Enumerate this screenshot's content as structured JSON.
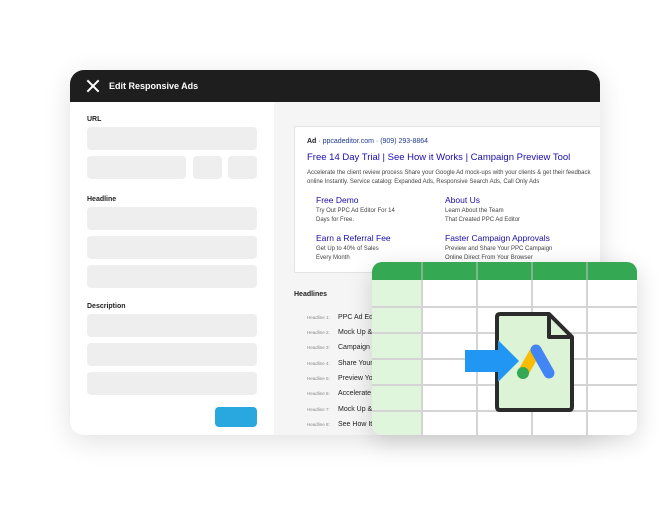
{
  "window": {
    "title": "Edit Responsive Ads",
    "close_icon": "close-icon"
  },
  "form": {
    "url_label": "URL",
    "headline_label": "Headline",
    "description_label": "Description",
    "submit_color": "#29a8e0"
  },
  "ad": {
    "badge": "Ad",
    "domain": "ppcadeditor.com",
    "phone": "(909) 293-8864",
    "title": "Free 14 Day Trial | See How it Works | Campaign Preview Tool",
    "description": "Accelerate the client review process Share your Google Ad mock-ups with your clients & get their feedback online Instantly. Service catalog: Expanded Ads, Responsive Search Ads, Call Only Ads",
    "sitelinks": [
      {
        "title": "Free Demo",
        "line1": "Try Out PPC Ad Editor For 14",
        "line2": "Days for Free."
      },
      {
        "title": "About Us",
        "line1": "Learn About the Team",
        "line2": "That Created PPC Ad Editor"
      },
      {
        "title": "Earn a Referral Fee",
        "line1": "Get Up to 40% of Sales",
        "line2": "Every Month"
      },
      {
        "title": "Faster Campaign Approvals",
        "line1": "Preview and Share Your PPC Campaign",
        "line2": "Online Direct From Your Browser"
      }
    ]
  },
  "headlines": {
    "heading": "Headlines",
    "items": [
      {
        "label": "Headline 1:",
        "text": "PPC Ad Edi"
      },
      {
        "label": "Headline 2:",
        "text": "Mock Up &"
      },
      {
        "label": "Headline 3:",
        "text": "Campaign"
      },
      {
        "label": "Headline 4:",
        "text": "Share Your"
      },
      {
        "label": "Headline 5:",
        "text": "Preview Yo"
      },
      {
        "label": "Headline 6:",
        "text": "Accelerate"
      },
      {
        "label": "Headline 7:",
        "text": "Mock Up &"
      },
      {
        "label": "Headline 8:",
        "text": "See How It"
      }
    ]
  },
  "spreadsheet": {
    "header_color": "#34a853",
    "column_highlight": "#dff5dc",
    "arrow_color": "#2196f3",
    "icons": [
      "spreadsheet-icon",
      "import-arrow-icon",
      "file-icon",
      "google-ads-logo-icon"
    ]
  }
}
